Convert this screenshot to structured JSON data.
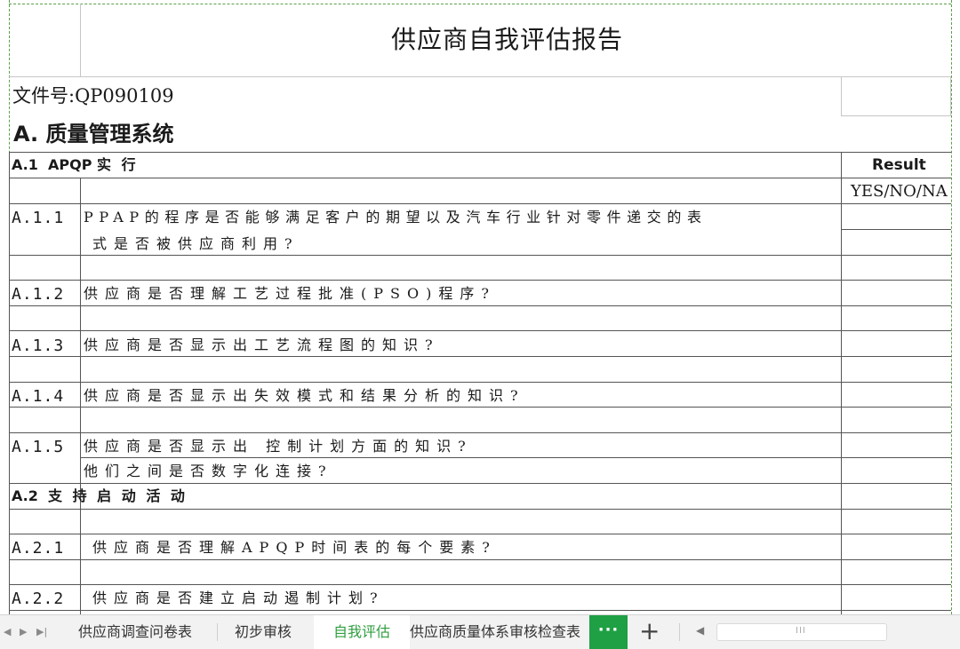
{
  "report": {
    "title": "供应商自我评估报告",
    "doc_number": "文件号:QP090109",
    "section_letter": "A.",
    "section_title": "质量管理系统"
  },
  "result_header": {
    "label": "Result",
    "options": "YES/NO/NA"
  },
  "subsections": [
    {
      "num": "A.1",
      "title_lat": "APQP",
      "title_cjk": "实 行"
    },
    {
      "num": "A.2",
      "title_lat": "",
      "title_cjk": "支 持 启 动 活 动"
    }
  ],
  "questions": [
    {
      "code": "A.1.1",
      "line1": "PPAP的程序是否能够满足客户的期望以及汽车行业针对零件递交的表",
      "line2": "式是否被供应商利用?"
    },
    {
      "code": "A.1.2",
      "line1": "供应商是否理解工艺过程批准(PSO)程序?"
    },
    {
      "code": "A.1.3",
      "line1": "供应商是否显示出工艺流程图的知识?"
    },
    {
      "code": "A.1.4",
      "line1": "供应商是否显示出失效模式和结果分析的知识?"
    },
    {
      "code": "A.1.5",
      "line1": "供应商是否显示出 控制计划方面的知识?",
      "line2": "他们之间是否数字化连接?"
    },
    {
      "code": "A.2.1",
      "line1": "供应商是否理解APQP时间表的每个要素?"
    },
    {
      "code": "A.2.2",
      "line1": "供应商是否建立启动遏制计划?"
    }
  ],
  "sheet_tabs": [
    {
      "label": "供应商调查问卷表",
      "active": false
    },
    {
      "label": "初步审核",
      "active": false
    },
    {
      "label": "自我评估",
      "active": true
    },
    {
      "label": "供应商质量体系审核检查表",
      "active": false
    }
  ],
  "tab_controls": {
    "more_label": "···",
    "add_label": "+",
    "nav_first": "◀",
    "nav_prev": "▶",
    "nav_last": "▶|",
    "scroll_left": "◀",
    "scroll_grip": "III"
  },
  "colors": {
    "accent_green": "#1fa045",
    "active_tab_text": "#2e9e3e",
    "print_area_dash": "#5aa04a"
  }
}
